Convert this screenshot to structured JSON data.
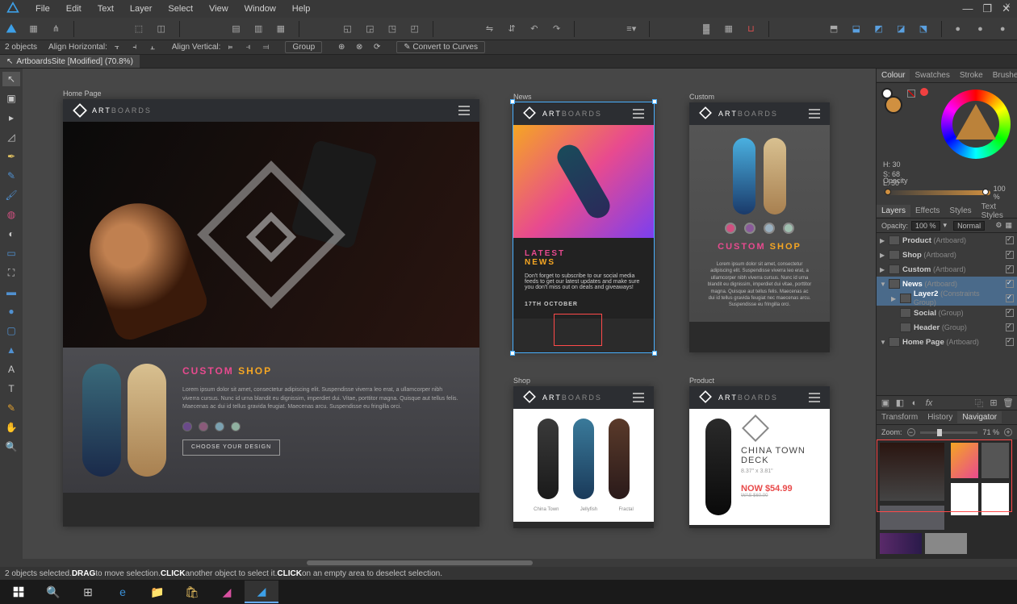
{
  "menu": {
    "items": [
      "File",
      "Edit",
      "Text",
      "Layer",
      "Select",
      "View",
      "Window",
      "Help"
    ]
  },
  "document": {
    "tab": "ArtboardsSite [Modified] (70.8%)"
  },
  "context": {
    "selection": "2 objects",
    "align_h": "Align Horizontal:",
    "align_v": "Align Vertical:",
    "group": "Group",
    "convert": "Convert to Curves"
  },
  "artboards": {
    "homepage": {
      "label": "Home Page",
      "brand_bold": "ART",
      "brand_light": "BOARDS",
      "custom_title_a": "CUSTOM",
      "custom_title_b": "SHOP",
      "custom_text": "Lorem ipsum dolor sit amet, consectetur adipiscing elit. Suspendisse viverra leo erat, a ullamcorper nibh viverra cursus. Nunc id urna blandit eu dignissim, imperdiet dui. Vitae, porttitor magna. Quisque aut tellus felis. Maecenas ac dui id tellus gravida feugiat. Maecenas arcu. Suspendisse eu fringilla orci.",
      "choose": "CHOOSE YOUR DESIGN"
    },
    "news": {
      "label": "News",
      "title_a": "LATEST",
      "title_b": "NEWS",
      "body": "Don't forget to subscribe to our social media feeds to get our latest updates and make sure you don't miss out on deals and giveaways!",
      "date": "17TH OCTOBER"
    },
    "custom": {
      "label": "Custom",
      "title_a": "CUSTOM",
      "title_b": "SHOP",
      "body": "Lorem ipsum dolor sit amet, consectetur adipiscing elit. Suspendisse viverra leo erat, a ullamcorper nibh viverra cursus. Nunc id urna blandit eu dignissim, imperdiet dui vitae, porttitor magna. Quisque aut tellus felis. Maecenas ac dui id tellus gravida feugiat nec maecenas arcu. Suspendisse eu fringilla orci."
    },
    "shop": {
      "label": "Shop",
      "items": [
        "China Town",
        "Jellyfish",
        "Fractal"
      ]
    },
    "product": {
      "label": "Product",
      "name": "CHINA TOWN DECK",
      "dim": "8.37\" x 3.81\"",
      "price": "NOW $54.99",
      "old": "WAS $60.00"
    }
  },
  "panels": {
    "colour_tabs": [
      "Colour",
      "Swatches",
      "Stroke",
      "Brushes"
    ],
    "hsl": {
      "h": "H: 30",
      "s": "S: 68",
      "l": "L: 50"
    },
    "opacity_label": "Opacity",
    "opacity_value": "100 %",
    "layer_tabs": [
      "Layers",
      "Effects",
      "Styles",
      "Text Styles"
    ],
    "layer_opacity_label": "Opacity:",
    "layer_opacity_value": "100 %",
    "layer_blend": "Normal",
    "layers": [
      {
        "arrow": "▶",
        "name": "Product",
        "type": "(Artboard)",
        "indent": 0
      },
      {
        "arrow": "▶",
        "name": "Shop",
        "type": "(Artboard)",
        "indent": 0
      },
      {
        "arrow": "▶",
        "name": "Custom",
        "type": "(Artboard)",
        "indent": 0
      },
      {
        "arrow": "▼",
        "name": "News",
        "type": "(Artboard)",
        "indent": 0,
        "sel": true
      },
      {
        "arrow": "▶",
        "name": "Layer2",
        "type": "(Constraints Group)",
        "indent": 1,
        "sel": true
      },
      {
        "arrow": "",
        "name": "Social",
        "type": "(Group)",
        "indent": 1
      },
      {
        "arrow": "",
        "name": "Header",
        "type": "(Group)",
        "indent": 1
      },
      {
        "arrow": "▼",
        "name": "Home Page",
        "type": "(Artboard)",
        "indent": 0
      }
    ],
    "nav_tabs": [
      "Transform",
      "History",
      "Navigator"
    ],
    "zoom_label": "Zoom:",
    "zoom_value": "71 %"
  },
  "status": {
    "text_a": "2 objects selected. ",
    "drag": "DRAG",
    "text_b": " to move selection. ",
    "click1": "CLICK",
    "text_c": " another object to select it. ",
    "click2": "CLICK",
    "text_d": " on an empty area to deselect selection."
  }
}
